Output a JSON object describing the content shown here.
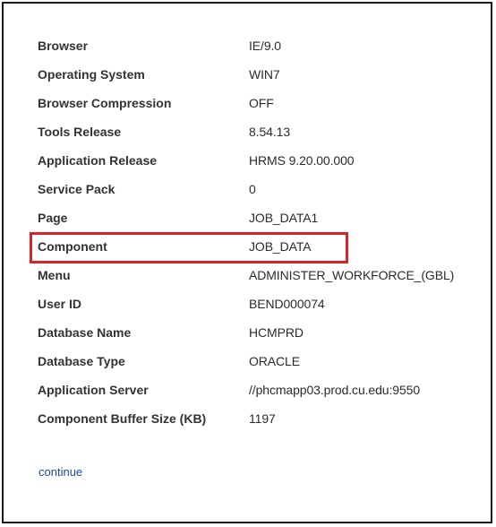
{
  "rows": [
    {
      "label": "Browser",
      "value": "IE/9.0"
    },
    {
      "label": "Operating System",
      "value": "WIN7"
    },
    {
      "label": "Browser Compression",
      "value": "OFF"
    },
    {
      "label": "Tools Release",
      "value": "8.54.13"
    },
    {
      "label": "Application Release",
      "value": "HRMS 9.20.00.000"
    },
    {
      "label": "Service Pack",
      "value": "0"
    },
    {
      "label": "Page",
      "value": "JOB_DATA1"
    },
    {
      "label": "Component",
      "value": "JOB_DATA"
    },
    {
      "label": "Menu",
      "value": "ADMINISTER_WORKFORCE_(GBL)"
    },
    {
      "label": "User ID",
      "value": "BEND000074"
    },
    {
      "label": "Database Name",
      "value": "HCMPRD"
    },
    {
      "label": "Database Type",
      "value": "ORACLE"
    },
    {
      "label": "Application Server",
      "value": "//phcmapp03.prod.cu.edu:9550"
    },
    {
      "label": "Component Buffer Size (KB)",
      "value": "1197"
    }
  ],
  "highlighted_row": "Component",
  "highlight_color": "#d9232a",
  "link_color": "#1a4a96",
  "continue_label": "continue"
}
